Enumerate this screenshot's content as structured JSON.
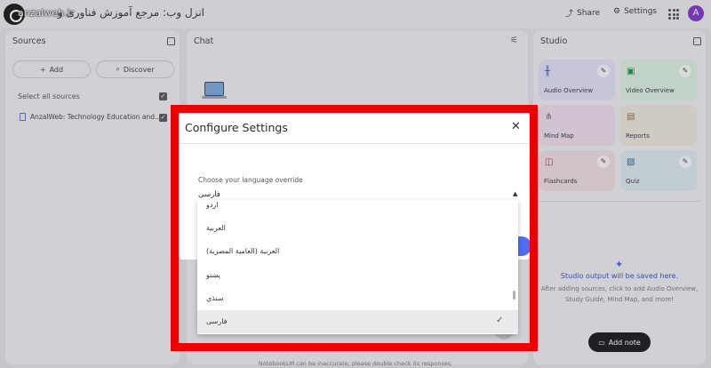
{
  "header": {
    "watermark": "anzalweb.ir",
    "notebook_title": "انزل وب: مرجع آموزش فناوری و",
    "share_label": "Share",
    "settings_label": "Settings",
    "avatar_letter": "A"
  },
  "sources": {
    "title": "Sources",
    "add_label": "Add",
    "discover_label": "Discover",
    "select_all_label": "Select all sources",
    "items": [
      {
        "label": "AnzalWeb: Technology Education and..."
      }
    ]
  },
  "chat": {
    "title": "Chat"
  },
  "studio": {
    "title": "Studio",
    "cards": [
      {
        "label": "Audio Overview",
        "icon": "audio-waveform-icon",
        "color": "#dcdcf0"
      },
      {
        "label": "Video Overview",
        "icon": "video-icon",
        "color": "#d6eadc"
      },
      {
        "label": "Mind Map",
        "icon": "mind-map-icon",
        "color": "#ead9e6"
      },
      {
        "label": "Reports",
        "icon": "report-icon",
        "color": "#e6e2d6"
      },
      {
        "label": "Flashcards",
        "icon": "flashcards-icon",
        "color": "#ead9e0"
      },
      {
        "label": "Quiz",
        "icon": "quiz-icon",
        "color": "#d8e4ea"
      }
    ],
    "output_title": "Studio output will be saved here.",
    "output_body": "After adding sources, click to add Audio Overview, Study Guide, Mind Map, and more!",
    "add_note_label": "Add note"
  },
  "footer": {
    "note": "NotebookLM can be inaccurate; please double check its responses."
  },
  "dialog": {
    "title": "Configure Settings",
    "language_label": "Choose your language override",
    "language_selected": "فارسی",
    "options": [
      {
        "label": "اردو",
        "selected": false
      },
      {
        "label": "العربية",
        "selected": false
      },
      {
        "label": "العربية (العامية المصرية)",
        "selected": false
      },
      {
        "label": "پښتو",
        "selected": false
      },
      {
        "label": "سنڌي",
        "selected": false
      },
      {
        "label": "فارسی",
        "selected": true
      }
    ]
  },
  "colors": {
    "highlight": "#ee0000",
    "accent": "#4f6cf5"
  }
}
